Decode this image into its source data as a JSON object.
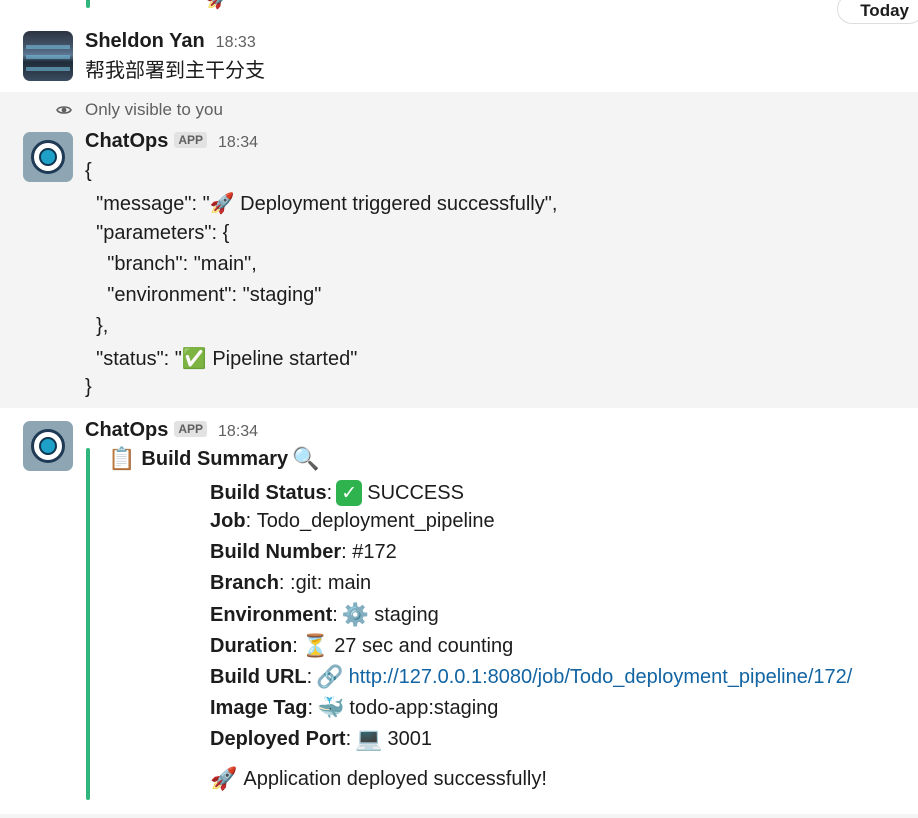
{
  "day_divider": {
    "label": "Today"
  },
  "prev_message": {
    "emoji": "🚀"
  },
  "message_user": {
    "author": "Sheldon Yan",
    "time": "18:33",
    "text": "帮我部署到主干分支"
  },
  "message_ephemeral": {
    "visibility_note": "Only visible to you",
    "author": "ChatOps",
    "badge": "APP",
    "time": "18:34",
    "json_lines": [
      "{",
      "  \"message\": \"🚀 Deployment triggered successfully\",",
      "  \"parameters\": {",
      "    \"branch\": \"main\",",
      "    \"environment\": \"staging\"",
      "  },",
      "  \"status\": \"✅ Pipeline started\"",
      "}"
    ]
  },
  "message_summary": {
    "author": "ChatOps",
    "badge": "APP",
    "time": "18:34",
    "title": "Build Summary",
    "title_icon_left": "clipboard-icon",
    "title_icon_right": "magnifier-icon",
    "fields": {
      "build_status": {
        "label": "Build Status",
        "value": "SUCCESS",
        "icon": "check-icon"
      },
      "job": {
        "label": "Job",
        "value": "Todo_deployment_pipeline"
      },
      "build_number": {
        "label": "Build Number",
        "value": "#172"
      },
      "branch": {
        "label": "Branch",
        "value": ":git: main"
      },
      "environment": {
        "label": "Environment",
        "value": "staging",
        "icon": "gear-icon"
      },
      "duration": {
        "label": "Duration",
        "value": "27 sec and counting",
        "icon": "hourglass-icon"
      },
      "build_url": {
        "label": "Build URL",
        "value": "http://127.0.0.1:8080/job/Todo_deployment_pipeline/172/",
        "icon": "link-icon"
      },
      "image_tag": {
        "label": "Image Tag",
        "value": "todo-app:staging",
        "icon": "whale-icon"
      },
      "deployed_port": {
        "label": "Deployed Port",
        "value": "3001",
        "icon": "laptop-icon"
      }
    },
    "footer": {
      "text": "Application deployed successfully!",
      "icon": "rocket-icon"
    }
  },
  "colors": {
    "accent_bar": "#2eb67d",
    "link": "#1264a3",
    "ephemeral_bg": "#f4f4f4",
    "muted_text": "#616061"
  }
}
